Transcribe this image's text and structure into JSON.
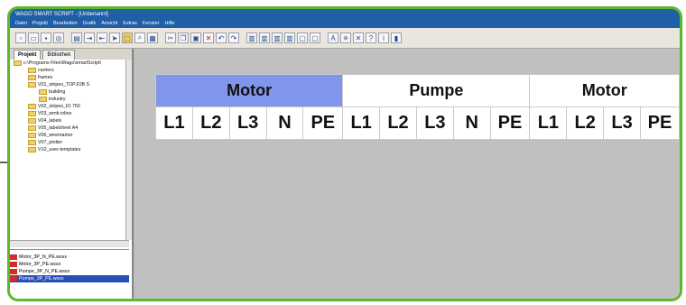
{
  "window": {
    "title": "WAGO SMART SCRIPT - [Unbenannt]"
  },
  "menu": [
    "Datei",
    "Projekt",
    "Bearbeiten",
    "Grafik",
    "Ansicht",
    "Extras",
    "Fenster",
    "Hilfe"
  ],
  "left_panel": {
    "tabs": [
      "Projekt",
      "Bibliothek"
    ],
    "tree": [
      {
        "label": "c:\\Programs Files\\Wago\\smartScript\\"
      },
      {
        "label": "carriers"
      },
      {
        "label": "frames"
      },
      {
        "label": "V01_stripes_TOPJOB S"
      },
      {
        "label": "building"
      },
      {
        "label": "industry"
      },
      {
        "label": "V02_stripes_IO 750"
      },
      {
        "label": "V03_wmb inline"
      },
      {
        "label": "V04_labels"
      },
      {
        "label": "V05_labelsheet A4"
      },
      {
        "label": "V06_wiremarker"
      },
      {
        "label": "V07_plotter"
      },
      {
        "label": "V10_user-templates"
      }
    ],
    "files": [
      {
        "label": "Motor_3P_N_PE.wssx"
      },
      {
        "label": "Motor_3P_PE.wssx"
      },
      {
        "label": "Pumpe_3P_N_PE.wssx"
      },
      {
        "label": "Pumpe_3P_PE.wssx"
      }
    ]
  },
  "grid": {
    "headers": [
      {
        "label": "Motor"
      },
      {
        "label": "Pumpe"
      },
      {
        "label": "Motor"
      }
    ],
    "cells": [
      "L1",
      "L2",
      "L3",
      "N",
      "PE",
      "L1",
      "L2",
      "L3",
      "N",
      "PE",
      "L1",
      "L2",
      "L3",
      "PE"
    ]
  },
  "colors": {
    "frame_green": "#5cb82e",
    "title_blue": "#1f5fa6",
    "header_highlight": "#7f96ea"
  }
}
